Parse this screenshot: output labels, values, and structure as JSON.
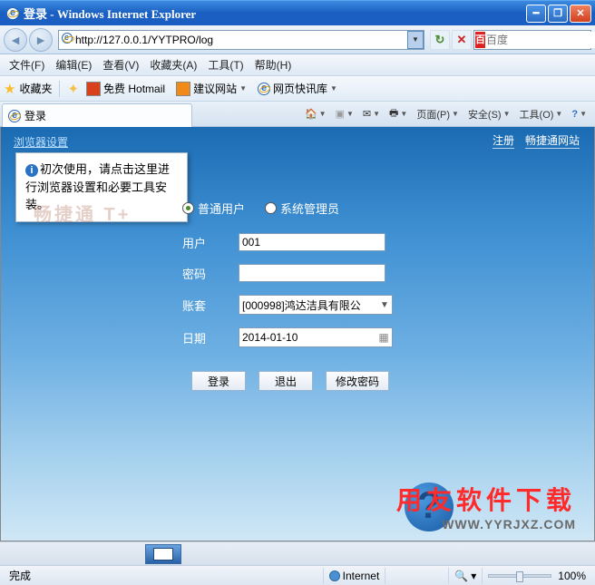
{
  "titlebar": {
    "title": "登录 - Windows Internet Explorer"
  },
  "nav": {
    "url": "http://127.0.0.1/YYTPRO/log",
    "search_provider": "百",
    "search_placeholder": "百度"
  },
  "menu": {
    "file": "文件(F)",
    "edit": "编辑(E)",
    "view": "查看(V)",
    "favorites": "收藏夹(A)",
    "tools": "工具(T)",
    "help": "帮助(H)"
  },
  "bookmarks_bar": {
    "favorites_label": "收藏夹",
    "items": [
      {
        "label": "免费 Hotmail"
      },
      {
        "label": "建议网站"
      },
      {
        "label": "网页快讯库"
      }
    ]
  },
  "tab": {
    "title": "登录"
  },
  "tab_tools": {
    "page": "页面(P)",
    "safety": "安全(S)",
    "tools": "工具(O)"
  },
  "page": {
    "settings_link": "浏览器设置",
    "register_link": "注册",
    "site_link": "畅捷通网站",
    "tooltip": "初次使用，请点击这里进行浏览器设置和必要工具安装。",
    "brand": "畅捷通 T+",
    "role_user": "普通用户",
    "role_admin": "系统管理员",
    "labels": {
      "user": "用户",
      "password": "密码",
      "account": "账套",
      "date": "日期"
    },
    "values": {
      "user": "001",
      "password": "",
      "account": "[000998]鸿达洁具有限公",
      "date": "2014-01-10"
    },
    "buttons": {
      "login": "登录",
      "exit": "退出",
      "change_pw": "修改密码"
    }
  },
  "watermark": {
    "line1": "用友软件下载",
    "line2": "WWW.YYRJXZ.COM"
  },
  "status": {
    "done": "完成",
    "zone": "Internet",
    "zoom": "100%"
  }
}
